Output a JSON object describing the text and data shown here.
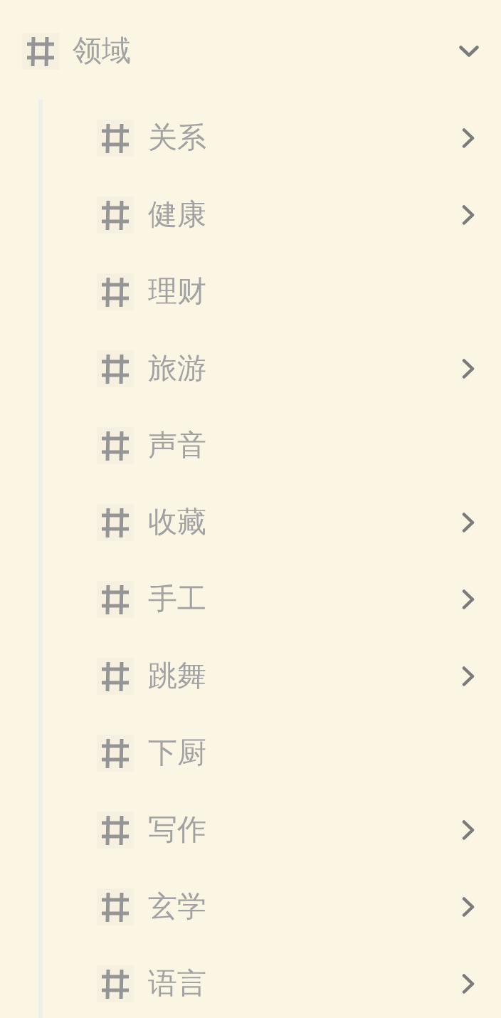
{
  "tag_tree": {
    "label": "领域",
    "expanded": true,
    "children": [
      {
        "label": "关系",
        "has_children": true
      },
      {
        "label": "健康",
        "has_children": true
      },
      {
        "label": "理财",
        "has_children": false
      },
      {
        "label": "旅游",
        "has_children": true
      },
      {
        "label": "声音",
        "has_children": false
      },
      {
        "label": "收藏",
        "has_children": true
      },
      {
        "label": "手工",
        "has_children": true
      },
      {
        "label": "跳舞",
        "has_children": true
      },
      {
        "label": "下厨",
        "has_children": false
      },
      {
        "label": "写作",
        "has_children": true
      },
      {
        "label": "玄学",
        "has_children": true
      },
      {
        "label": "语言",
        "has_children": true
      }
    ]
  }
}
